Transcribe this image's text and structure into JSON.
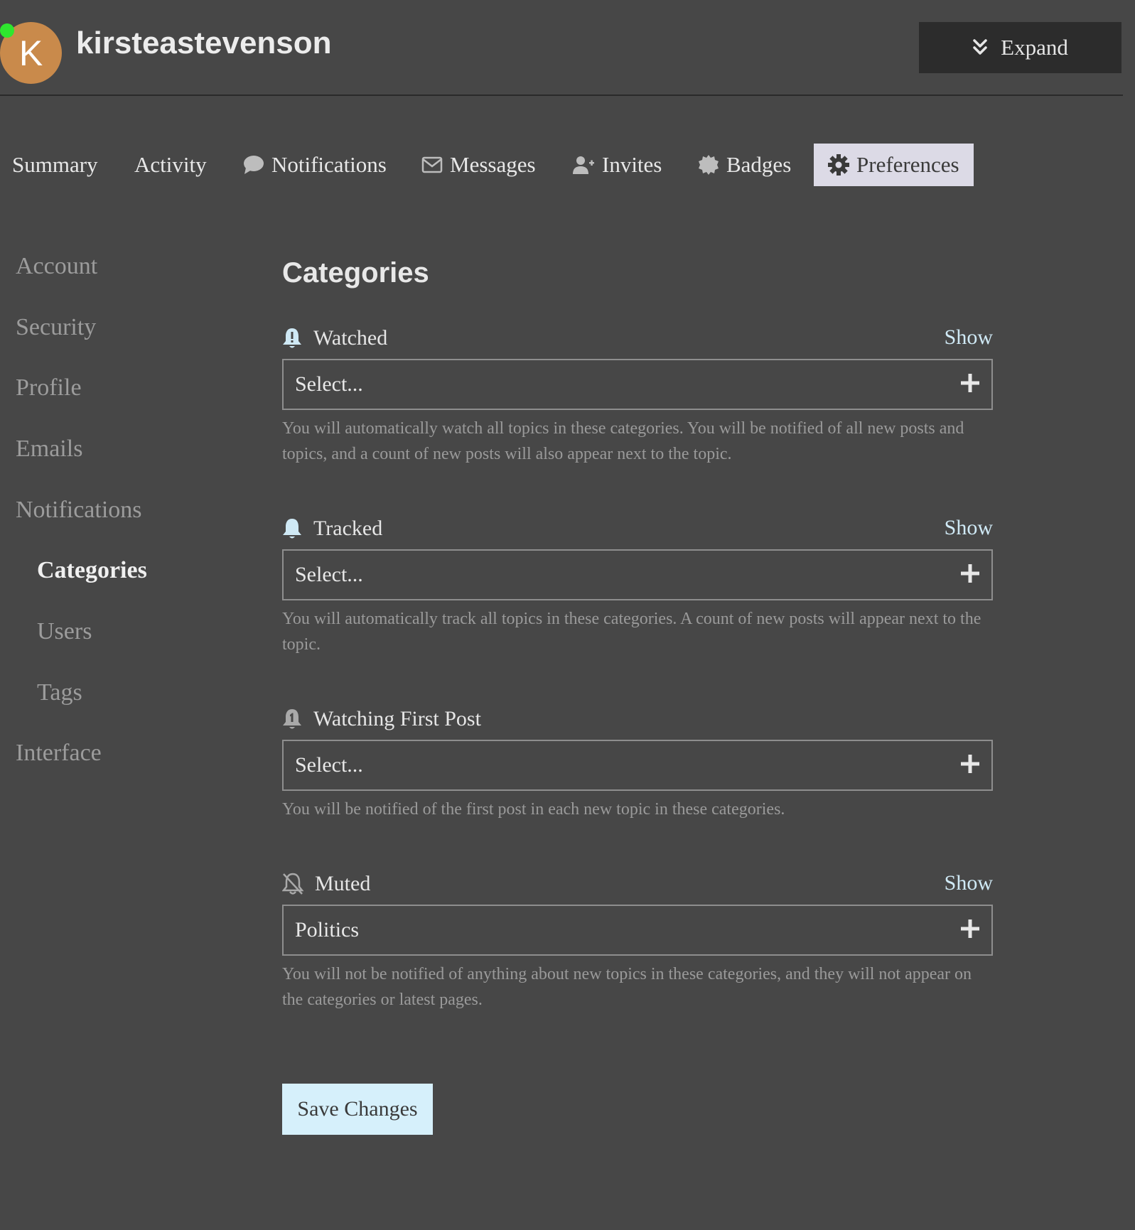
{
  "header": {
    "avatar_letter": "K",
    "username": "kirsteastevenson",
    "expand_label": "Expand"
  },
  "tabs": [
    {
      "label": "Summary"
    },
    {
      "label": "Activity"
    },
    {
      "label": "Notifications",
      "icon": "comment-icon"
    },
    {
      "label": "Messages",
      "icon": "envelope-icon"
    },
    {
      "label": "Invites",
      "icon": "user-plus-icon"
    },
    {
      "label": "Badges",
      "icon": "badge-icon"
    },
    {
      "label": "Preferences",
      "icon": "gear-icon",
      "active": true
    }
  ],
  "sidebar": {
    "items": [
      {
        "label": "Account"
      },
      {
        "label": "Security"
      },
      {
        "label": "Profile"
      },
      {
        "label": "Emails"
      },
      {
        "label": "Notifications"
      },
      {
        "label": "Categories",
        "active": true
      },
      {
        "label": "Users"
      },
      {
        "label": "Tags"
      },
      {
        "label": "Interface"
      }
    ]
  },
  "main": {
    "title": "Categories",
    "show_label": "Show",
    "sections": [
      {
        "label": "Watched",
        "icon": "bell-exclamation-icon",
        "value": "Select...",
        "description": "You will automatically watch all topics in these categories. You will be notified of all new posts and topics, and a count of new posts will also appear next to the topic."
      },
      {
        "label": "Tracked",
        "icon": "bell-icon",
        "value": "Select...",
        "description": "You will automatically track all topics in these categories. A count of new posts will appear next to the topic."
      },
      {
        "label": "Watching First Post",
        "icon": "bell-one-icon",
        "value": "Select...",
        "description": "You will be notified of the first post in each new topic in these categories."
      },
      {
        "label": "Muted",
        "icon": "bell-slash-icon",
        "value": "Politics",
        "description": "You will not be notified of anything about new topics in these categories, and they will not appear on the categories or latest pages."
      }
    ],
    "save_label": "Save Changes"
  },
  "colors": {
    "background": "#474747",
    "accent_link": "#cfe9f5",
    "save_button": "#d6f0fb",
    "active_tab": "#dcdae6",
    "avatar": "#c98a4b",
    "online": "#2ee62e"
  }
}
